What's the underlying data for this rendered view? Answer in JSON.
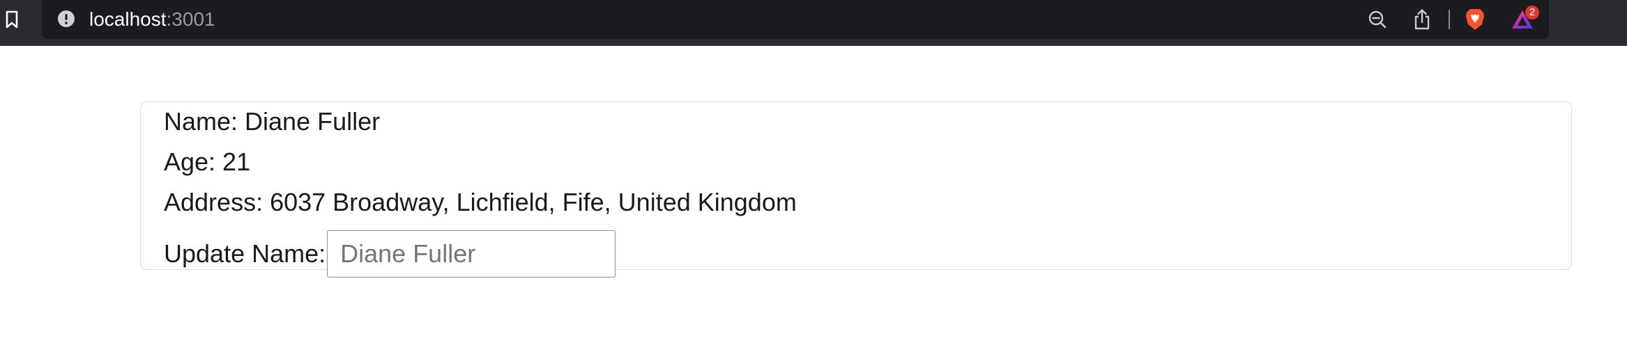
{
  "browser": {
    "url_host": "localhost",
    "url_port": ":3001",
    "notification_count": "2",
    "icons": {
      "bookmark": "bookmark-icon",
      "site_info": "info-icon",
      "zoom": "zoom-out-icon",
      "share": "share-icon",
      "brave": "brave-shield-icon",
      "rewards": "brave-rewards-icon"
    },
    "colors": {
      "chrome_bg": "#2a2b30",
      "urlbar_bg": "#1b1c20",
      "brave_orange": "#fb542b",
      "badge_red": "#e0362c"
    }
  },
  "person": {
    "name_line": "Name: Diane Fuller",
    "age_line": "Age: 21",
    "address_line": "Address: 6037 Broadway, Lichfield, Fife, United Kingdom",
    "update_label": "Update Name:",
    "update_placeholder": "Diane Fuller"
  }
}
